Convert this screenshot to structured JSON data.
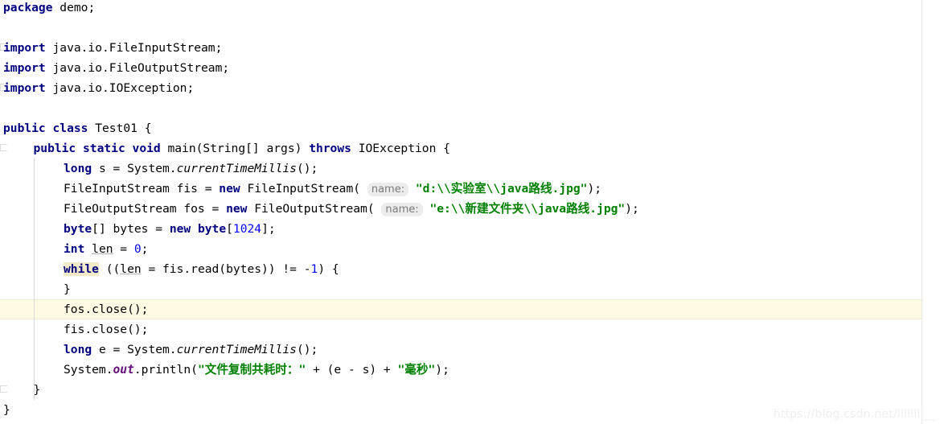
{
  "editor": {
    "language": "java",
    "theme": "IntelliJ Light",
    "colors": {
      "background": "#ffffff",
      "keyword": "#000080",
      "string": "#008000",
      "number": "#0000ff",
      "static_field": "#660e7a",
      "inlay_hint_text": "#7a7a7a",
      "inlay_hint_background": "#ececec",
      "caret_line_background": "#fffae3",
      "identifier_highlight": "#f2e9c8",
      "indent_guide": "#d8d8d8",
      "right_margin_rule": "#e8e8e8",
      "watermark": "#efefef"
    },
    "caret_line_number": 16,
    "highlighted_keyword": "while",
    "watermark": "https://blog.csdn.net/llllllll__",
    "lines": [
      {
        "n": 1,
        "indent": 0,
        "fold": false,
        "tokens": [
          {
            "t": "package",
            "c": "kw"
          },
          {
            "t": " demo;",
            "c": "plain"
          }
        ]
      },
      {
        "n": 2,
        "indent": 0,
        "fold": false,
        "tokens": []
      },
      {
        "n": 3,
        "indent": 0,
        "fold": true,
        "tokens": [
          {
            "t": "import",
            "c": "kw"
          },
          {
            "t": " java.io.FileInputStream;",
            "c": "plain"
          }
        ]
      },
      {
        "n": 4,
        "indent": 0,
        "fold": false,
        "tokens": [
          {
            "t": "import",
            "c": "kw"
          },
          {
            "t": " java.io.FileOutputStream;",
            "c": "plain"
          }
        ]
      },
      {
        "n": 5,
        "indent": 0,
        "fold": true,
        "tokens": [
          {
            "t": "import",
            "c": "kw"
          },
          {
            "t": " java.io.IOException;",
            "c": "plain"
          }
        ]
      },
      {
        "n": 6,
        "indent": 0,
        "fold": false,
        "tokens": []
      },
      {
        "n": 7,
        "indent": 0,
        "fold": false,
        "tokens": [
          {
            "t": "public",
            "c": "kw"
          },
          {
            "t": " ",
            "c": "plain"
          },
          {
            "t": "class",
            "c": "kw"
          },
          {
            "t": " Test01 {",
            "c": "plain"
          }
        ]
      },
      {
        "n": 8,
        "indent": 1,
        "fold": true,
        "tokens": [
          {
            "t": "public",
            "c": "kw"
          },
          {
            "t": " ",
            "c": "plain"
          },
          {
            "t": "static",
            "c": "kw"
          },
          {
            "t": " ",
            "c": "plain"
          },
          {
            "t": "void",
            "c": "kw"
          },
          {
            "t": " main(String[] args) ",
            "c": "plain"
          },
          {
            "t": "throws",
            "c": "kw"
          },
          {
            "t": " IOException {",
            "c": "plain"
          }
        ]
      },
      {
        "n": 9,
        "indent": 2,
        "fold": false,
        "tokens": [
          {
            "t": "long",
            "c": "kw"
          },
          {
            "t": " s = System.",
            "c": "plain"
          },
          {
            "t": "currentTimeMillis",
            "c": "stat"
          },
          {
            "t": "();",
            "c": "plain"
          }
        ]
      },
      {
        "n": 10,
        "indent": 2,
        "fold": false,
        "tokens": [
          {
            "t": "FileInputStream fis = ",
            "c": "plain"
          },
          {
            "t": "new",
            "c": "kw"
          },
          {
            "t": " FileInputStream(",
            "c": "plain"
          },
          {
            "t": " ",
            "c": "plain"
          },
          {
            "t": "name:",
            "c": "hint"
          },
          {
            "t": " ",
            "c": "plain"
          },
          {
            "t": "\"d:\\\\实验室\\\\java路线.jpg\"",
            "c": "str"
          },
          {
            "t": ");",
            "c": "plain"
          }
        ]
      },
      {
        "n": 11,
        "indent": 2,
        "fold": false,
        "tokens": [
          {
            "t": "FileOutputStream fos = ",
            "c": "plain"
          },
          {
            "t": "new",
            "c": "kw"
          },
          {
            "t": " FileOutputStream(",
            "c": "plain"
          },
          {
            "t": " ",
            "c": "plain"
          },
          {
            "t": "name:",
            "c": "hint"
          },
          {
            "t": " ",
            "c": "plain"
          },
          {
            "t": "\"e:\\\\新建文件夹\\\\java路线.jpg\"",
            "c": "str"
          },
          {
            "t": ");",
            "c": "plain"
          }
        ]
      },
      {
        "n": 12,
        "indent": 2,
        "fold": false,
        "tokens": [
          {
            "t": "byte",
            "c": "kw"
          },
          {
            "t": "[] bytes = ",
            "c": "plain"
          },
          {
            "t": "new",
            "c": "kw"
          },
          {
            "t": " ",
            "c": "plain"
          },
          {
            "t": "byte",
            "c": "kw"
          },
          {
            "t": "[",
            "c": "plain"
          },
          {
            "t": "1024",
            "c": "num"
          },
          {
            "t": "];",
            "c": "plain"
          }
        ]
      },
      {
        "n": 13,
        "indent": 2,
        "fold": false,
        "tokens": [
          {
            "t": "int",
            "c": "kw"
          },
          {
            "t": " ",
            "c": "plain"
          },
          {
            "t": "len",
            "c": "field"
          },
          {
            "t": " = ",
            "c": "plain"
          },
          {
            "t": "0",
            "c": "num"
          },
          {
            "t": ";",
            "c": "plain"
          }
        ]
      },
      {
        "n": 14,
        "indent": 2,
        "fold": false,
        "tokens": [
          {
            "t": "while",
            "c": "kw hl"
          },
          {
            "t": " ((",
            "c": "plain"
          },
          {
            "t": "len",
            "c": "field"
          },
          {
            "t": " = fis.read(bytes)) != ",
            "c": "plain"
          },
          {
            "t": "-",
            "c": "plain"
          },
          {
            "t": "1",
            "c": "num"
          },
          {
            "t": ") {",
            "c": "plain"
          }
        ]
      },
      {
        "n": 15,
        "indent": 2,
        "fold": false,
        "tokens": [
          {
            "t": "}",
            "c": "plain"
          }
        ]
      },
      {
        "n": 16,
        "indent": 2,
        "fold": false,
        "caret": true,
        "tokens": [
          {
            "t": "fos.close();",
            "c": "plain"
          }
        ]
      },
      {
        "n": 17,
        "indent": 2,
        "fold": false,
        "tokens": [
          {
            "t": "fis.close();",
            "c": "plain"
          }
        ]
      },
      {
        "n": 18,
        "indent": 2,
        "fold": false,
        "tokens": [
          {
            "t": "long",
            "c": "kw"
          },
          {
            "t": " e = System.",
            "c": "plain"
          },
          {
            "t": "currentTimeMillis",
            "c": "stat"
          },
          {
            "t": "();",
            "c": "plain"
          }
        ]
      },
      {
        "n": 19,
        "indent": 2,
        "fold": false,
        "tokens": [
          {
            "t": "System.",
            "c": "plain"
          },
          {
            "t": "out",
            "c": "statfld"
          },
          {
            "t": ".println(",
            "c": "plain"
          },
          {
            "t": "\"文件复制共耗时：\"",
            "c": "str"
          },
          {
            "t": " + (e - s) + ",
            "c": "plain"
          },
          {
            "t": "\"毫秒\"",
            "c": "str"
          },
          {
            "t": ");",
            "c": "plain"
          }
        ]
      },
      {
        "n": 20,
        "indent": 1,
        "fold": true,
        "tokens": [
          {
            "t": "}",
            "c": "plain"
          }
        ]
      },
      {
        "n": 21,
        "indent": 0,
        "fold": false,
        "tokens": [
          {
            "t": "}",
            "c": "plain"
          }
        ]
      }
    ]
  }
}
